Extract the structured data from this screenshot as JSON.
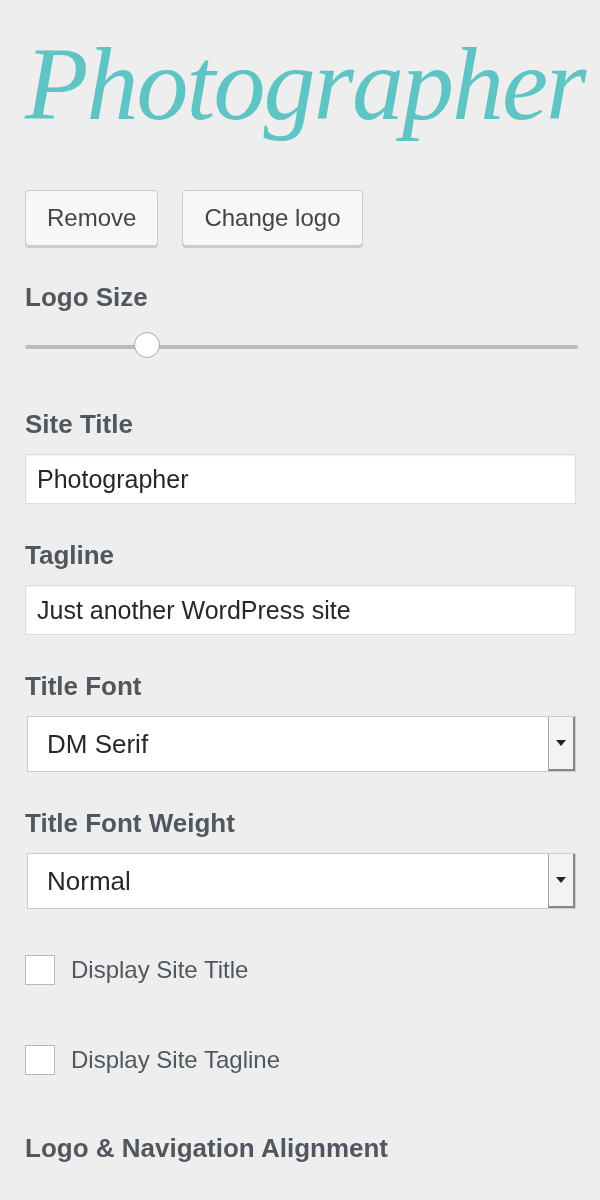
{
  "logo": {
    "text": "Photographer"
  },
  "logo_buttons": [
    "Remove",
    "Change logo"
  ],
  "logo_size": {
    "label": "Logo Size",
    "level": 0.22
  },
  "fields": [
    {
      "kind": "text",
      "label": "Site Title",
      "value": "Photographer"
    },
    {
      "kind": "text",
      "label": "Tagline",
      "value": "Just another WordPress site"
    },
    {
      "kind": "select",
      "label": "Title Font",
      "value": "DM Serif"
    },
    {
      "kind": "select",
      "label": "Title Font Weight",
      "value": "Normal"
    }
  ],
  "checkboxes": [
    {
      "label": "Display Site Title",
      "checked": false
    },
    {
      "label": "Display Site Tagline",
      "checked": false
    }
  ],
  "next_section": {
    "label": "Logo & Navigation Alignment"
  }
}
